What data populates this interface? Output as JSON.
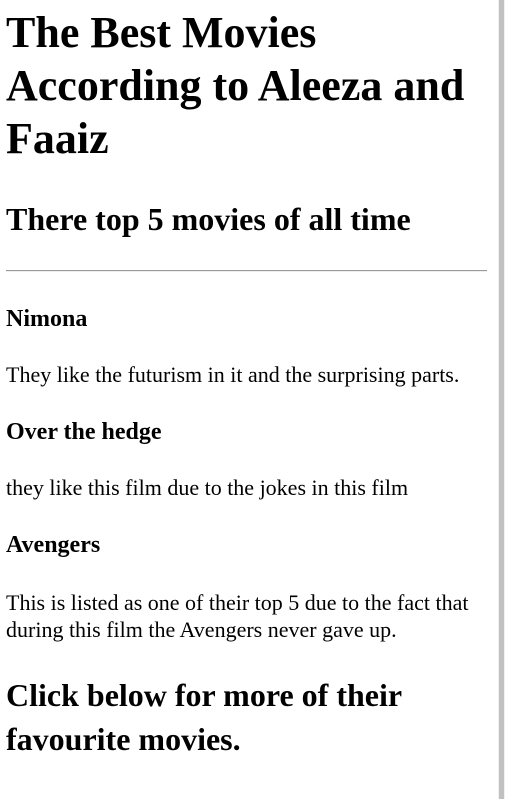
{
  "page": {
    "title": "The Best Movies According to Aleeza and Faaiz",
    "subtitle": "There top 5 movies of all time",
    "movies": [
      {
        "name": "Nimona",
        "description": "They like the futurism in it and the surprising parts."
      },
      {
        "name": "Over the hedge",
        "description": "they like this film due to the jokes in this film"
      },
      {
        "name": "Avengers",
        "description": "This is listed as one of their top 5 due to the fact that during this film the Avengers never gave up."
      }
    ],
    "cta_heading": "Click below for more of their favourite movies."
  }
}
